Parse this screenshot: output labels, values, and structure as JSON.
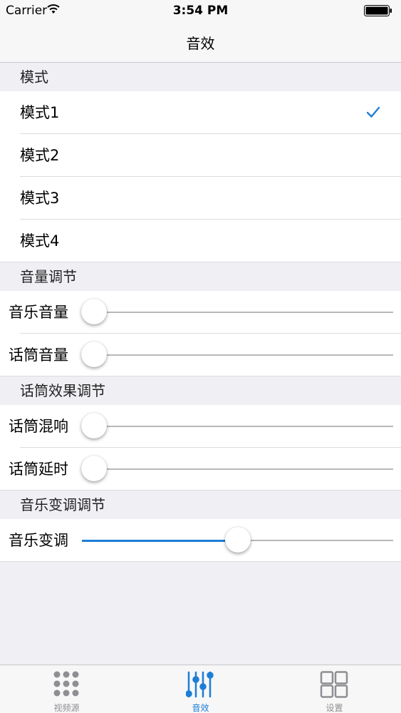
{
  "status_bar": {
    "carrier": "Carrier",
    "time": "3:54 PM"
  },
  "nav": {
    "title": "音效"
  },
  "sections": {
    "mode": {
      "header": "模式",
      "items": [
        {
          "label": "模式1",
          "selected": true
        },
        {
          "label": "模式2",
          "selected": false
        },
        {
          "label": "模式3",
          "selected": false
        },
        {
          "label": "模式4",
          "selected": false
        }
      ]
    },
    "volume": {
      "header": "音量调节",
      "sliders": [
        {
          "label": "音乐音量",
          "value": 0.04
        },
        {
          "label": "话筒音量",
          "value": 0.04
        }
      ]
    },
    "mic_effect": {
      "header": "话筒效果调节",
      "sliders": [
        {
          "label": "话筒混响",
          "value": 0.04
        },
        {
          "label": "话筒延时",
          "value": 0.04
        }
      ]
    },
    "pitch": {
      "header": "音乐变调调节",
      "sliders": [
        {
          "label": "音乐变调",
          "value": 0.5
        }
      ]
    }
  },
  "tabs": [
    {
      "label": "视频源",
      "icon": "grid-dots-icon",
      "active": false
    },
    {
      "label": "音效",
      "icon": "equalizer-icon",
      "active": true
    },
    {
      "label": "设置",
      "icon": "squares-icon",
      "active": false
    }
  ],
  "colors": {
    "accent": "#1d7ed6",
    "inactive": "#8e8e93"
  }
}
